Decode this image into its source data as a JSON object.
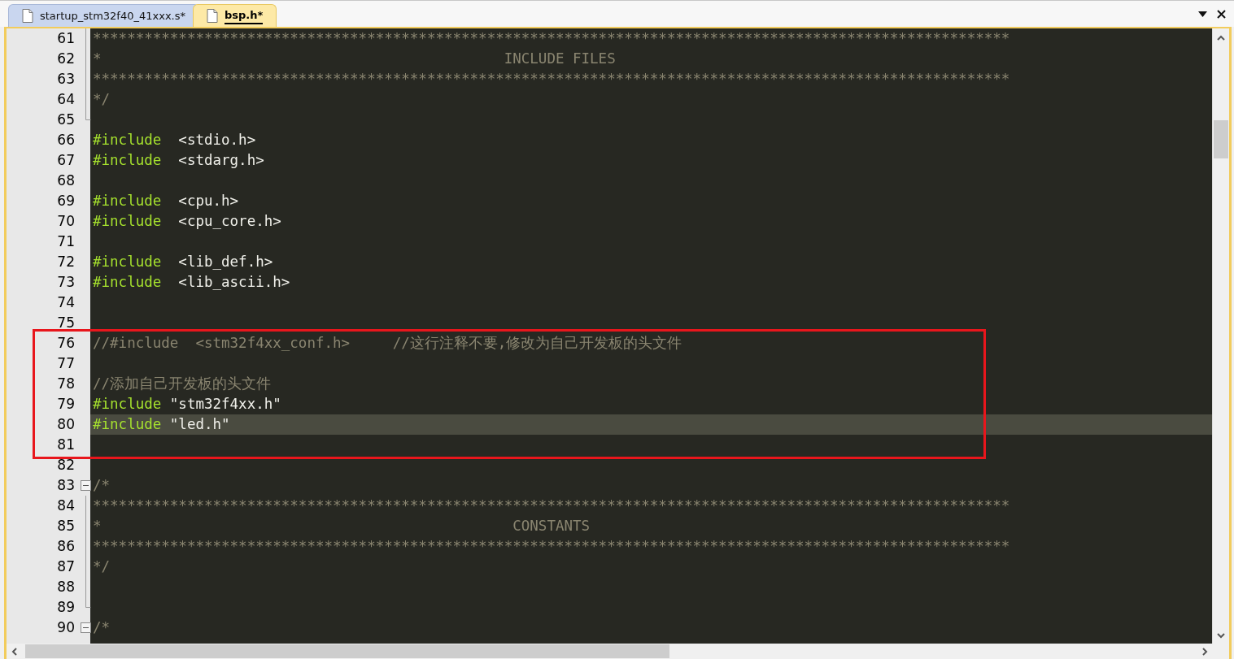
{
  "tabs": [
    {
      "label": "startup_stm32f40_41xxx.s*",
      "selected": false
    },
    {
      "label": "bsp.h*",
      "selected": true
    }
  ],
  "lines": [
    {
      "number": "61",
      "fold_box": false,
      "fold_line": true,
      "tokens": [
        {
          "kind": "comment",
          "text": "***********************************************************************************************************"
        }
      ]
    },
    {
      "number": "62",
      "fold_box": false,
      "fold_line": true,
      "tokens": [
        {
          "kind": "comment",
          "text": "*                                               INCLUDE FILES"
        }
      ]
    },
    {
      "number": "63",
      "fold_box": false,
      "fold_line": true,
      "tokens": [
        {
          "kind": "comment",
          "text": "***********************************************************************************************************"
        }
      ]
    },
    {
      "number": "64",
      "fold_box": false,
      "fold_line": true,
      "tokens": [
        {
          "kind": "comment",
          "text": "*/"
        }
      ]
    },
    {
      "number": "65",
      "fold_box": false,
      "fold_line": true
    },
    {
      "number": "66",
      "fold_box": false,
      "fold_line": false,
      "tokens": [
        {
          "kind": "keyword",
          "text": "#include"
        },
        {
          "kind": "text",
          "text": "  <stdio.h>"
        }
      ]
    },
    {
      "number": "67",
      "fold_box": false,
      "fold_line": false,
      "tokens": [
        {
          "kind": "keyword",
          "text": "#include"
        },
        {
          "kind": "text",
          "text": "  <stdarg.h>"
        }
      ]
    },
    {
      "number": "68",
      "fold_box": false,
      "fold_line": false
    },
    {
      "number": "69",
      "fold_box": false,
      "fold_line": false,
      "tokens": [
        {
          "kind": "keyword",
          "text": "#include"
        },
        {
          "kind": "text",
          "text": "  <cpu.h>"
        }
      ]
    },
    {
      "number": "70",
      "fold_box": false,
      "fold_line": false,
      "tokens": [
        {
          "kind": "keyword",
          "text": "#include"
        },
        {
          "kind": "text",
          "text": "  <cpu_core.h>"
        }
      ]
    },
    {
      "number": "71",
      "fold_box": false,
      "fold_line": false
    },
    {
      "number": "72",
      "fold_box": false,
      "fold_line": false,
      "tokens": [
        {
          "kind": "keyword",
          "text": "#include"
        },
        {
          "kind": "text",
          "text": "  <lib_def.h>"
        }
      ]
    },
    {
      "number": "73",
      "fold_box": false,
      "fold_line": false,
      "tokens": [
        {
          "kind": "keyword",
          "text": "#include"
        },
        {
          "kind": "text",
          "text": "  <lib_ascii.h>"
        }
      ]
    },
    {
      "number": "74",
      "fold_box": false,
      "fold_line": false
    },
    {
      "number": "75",
      "fold_box": false,
      "fold_line": false
    },
    {
      "number": "76",
      "fold_box": false,
      "fold_line": false,
      "boxed": true,
      "tokens": [
        {
          "kind": "comment",
          "text": "//#include  <stm32f4xx_conf.h>     //这行注释不要,修改为自己开发板的头文件"
        }
      ]
    },
    {
      "number": "77",
      "fold_box": false,
      "fold_line": false,
      "boxed": true
    },
    {
      "number": "78",
      "fold_box": false,
      "fold_line": false,
      "boxed": true,
      "tokens": [
        {
          "kind": "comment",
          "text": "//添加自己开发板的头文件"
        }
      ]
    },
    {
      "number": "79",
      "fold_box": false,
      "fold_line": false,
      "boxed": true,
      "tokens": [
        {
          "kind": "keyword",
          "text": "#include"
        },
        {
          "kind": "text",
          "text": " \"stm32f4xx.h\""
        }
      ]
    },
    {
      "number": "80",
      "fold_box": false,
      "fold_line": false,
      "boxed": true,
      "current": true,
      "tokens": [
        {
          "kind": "keyword",
          "text": "#include"
        },
        {
          "kind": "text",
          "text": " \"led.h\""
        }
      ]
    },
    {
      "number": "81",
      "fold_box": false,
      "fold_line": false,
      "boxed": true
    },
    {
      "number": "82",
      "fold_box": false,
      "fold_line": false
    },
    {
      "number": "83",
      "fold_box": true,
      "fold_line": false,
      "tokens": [
        {
          "kind": "comment",
          "text": "/*"
        }
      ]
    },
    {
      "number": "84",
      "fold_box": false,
      "fold_line": true,
      "tokens": [
        {
          "kind": "comment",
          "text": "***********************************************************************************************************"
        }
      ]
    },
    {
      "number": "85",
      "fold_box": false,
      "fold_line": true,
      "tokens": [
        {
          "kind": "comment",
          "text": "*                                                CONSTANTS"
        }
      ]
    },
    {
      "number": "86",
      "fold_box": false,
      "fold_line": true,
      "tokens": [
        {
          "kind": "comment",
          "text": "***********************************************************************************************************"
        }
      ]
    },
    {
      "number": "87",
      "fold_box": false,
      "fold_line": true,
      "tokens": [
        {
          "kind": "comment",
          "text": "*/"
        }
      ]
    },
    {
      "number": "88",
      "fold_box": false,
      "fold_line": true
    },
    {
      "number": "89",
      "fold_box": false,
      "fold_line": true
    },
    {
      "number": "90",
      "fold_box": true,
      "fold_line": false,
      "tokens": [
        {
          "kind": "comment",
          "text": "/*"
        }
      ]
    }
  ]
}
